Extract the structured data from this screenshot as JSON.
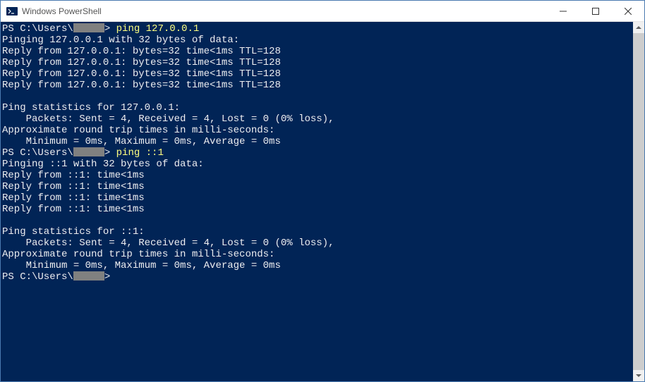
{
  "window": {
    "title": "Windows PowerShell"
  },
  "prompt": {
    "prefix": "PS C:\\Users\\",
    "suffix": "> "
  },
  "block1": {
    "cmd": "ping 127.0.0.1",
    "l1": "Pinging 127.0.0.1 with 32 bytes of data:",
    "l2": "Reply from 127.0.0.1: bytes=32 time<1ms TTL=128",
    "l3": "Reply from 127.0.0.1: bytes=32 time<1ms TTL=128",
    "l4": "Reply from 127.0.0.1: bytes=32 time<1ms TTL=128",
    "l5": "Reply from 127.0.0.1: bytes=32 time<1ms TTL=128",
    "s1": "Ping statistics for 127.0.0.1:",
    "s2": "    Packets: Sent = 4, Received = 4, Lost = 0 (0% loss),",
    "s3": "Approximate round trip times in milli-seconds:",
    "s4": "    Minimum = 0ms, Maximum = 0ms, Average = 0ms"
  },
  "block2": {
    "cmd": "ping ::1",
    "l1": "Pinging ::1 with 32 bytes of data:",
    "l2": "Reply from ::1: time<1ms",
    "l3": "Reply from ::1: time<1ms",
    "l4": "Reply from ::1: time<1ms",
    "l5": "Reply from ::1: time<1ms",
    "s1": "Ping statistics for ::1:",
    "s2": "    Packets: Sent = 4, Received = 4, Lost = 0 (0% loss),",
    "s3": "Approximate round trip times in milli-seconds:",
    "s4": "    Minimum = 0ms, Maximum = 0ms, Average = 0ms"
  }
}
